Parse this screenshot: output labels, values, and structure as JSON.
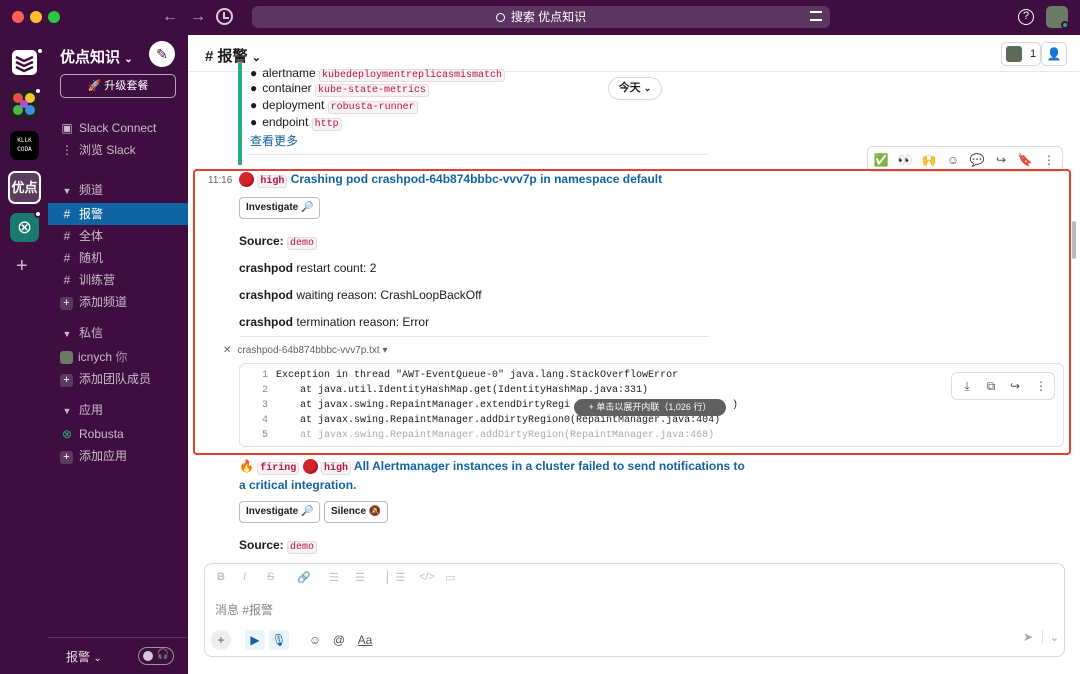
{
  "window": {
    "search_placeholder": "搜索 优点知识"
  },
  "colors": {
    "aubergine": "#3f0e40",
    "active": "#1164a3",
    "link": "#1264a3",
    "alert_border": "#e0402f",
    "presence": "#2bac76"
  },
  "workspace": {
    "name": "优点知识",
    "upgrade": "升级套餐"
  },
  "rail": {
    "workspaces": [
      "Todoist",
      "Colorful",
      "KLLK CODA",
      "优点",
      "Robusta"
    ],
    "active_label": "优点"
  },
  "sidebar": {
    "top_items": [
      {
        "icon": "slack-connect-icon",
        "label": "Slack Connect"
      },
      {
        "icon": "vertical-dots-icon",
        "label": "浏览 Slack"
      }
    ],
    "channels_header": "频道",
    "channels": [
      {
        "label": "报警",
        "active": true
      },
      {
        "label": "全体"
      },
      {
        "label": "随机"
      },
      {
        "label": "训练营"
      }
    ],
    "add_channel": "添加频道",
    "dm_header": "私信",
    "dm_user": "icnych",
    "dm_you": "你",
    "add_member": "添加团队成员",
    "apps_header": "应用",
    "app": "Robusta",
    "add_app": "添加应用",
    "footer_label": "报警"
  },
  "header": {
    "channel": "# 报警",
    "member_count": "1"
  },
  "previous": {
    "clipped_label": "alertname",
    "clipped_value": "kubedeploymentreplicasmismatch",
    "rows": [
      {
        "label": "container",
        "value": "kube-state-metrics"
      },
      {
        "label": "deployment",
        "value": "robusta-runner"
      },
      {
        "label": "endpoint",
        "value": "http"
      }
    ],
    "more": "查看更多"
  },
  "date_pill": "今天",
  "message": {
    "time": "11:16",
    "severity": "high",
    "title": "Crashing pod crashpod-64b874bbbc-vvv7p in namespace default",
    "investigate": "Investigate",
    "source_label": "Source:",
    "source_value": "demo",
    "fields": [
      {
        "bold": "crashpod",
        "text": "restart count: 2"
      },
      {
        "bold": "crashpod",
        "text": "waiting reason: CrashLoopBackOff"
      },
      {
        "bold": "crashpod",
        "text": "termination reason: Error"
      }
    ],
    "file_name": "crashpod-64b874bbbc-vvv7p.txt",
    "code": [
      {
        "n": "1",
        "t": "Exception in thread \"AWT-EventQueue-0\" java.lang.StackOverflowError"
      },
      {
        "n": "2",
        "t": "    at java.util.IdentityHashMap.get(IdentityHashMap.java:331)"
      },
      {
        "n": "3",
        "t": "    at javax.swing.RepaintManager.extendDirtyRegi"
      },
      {
        "n": "4",
        "t": "    at javax.swing.RepaintManager.addDirtyRegion0(RepaintManager.java:404)"
      },
      {
        "n": "5",
        "t": "    at javax.swing.RepaintManager.addDirtyRegion(RepaintManager.java:468)"
      }
    ],
    "code3_tail": ")",
    "expand": "+ 单击以展开内联（1,026 行）"
  },
  "next_message": {
    "firing": "firing",
    "severity": "high",
    "title_line1": "All Alertmanager instances in a cluster failed to send notifications to",
    "title_line2": "a critical integration.",
    "investigate": "Investigate",
    "silence": "Silence",
    "source_label": "Source:",
    "source_value": "demo"
  },
  "composer": {
    "placeholder": "消息 #报警",
    "format_label": "Aa"
  }
}
